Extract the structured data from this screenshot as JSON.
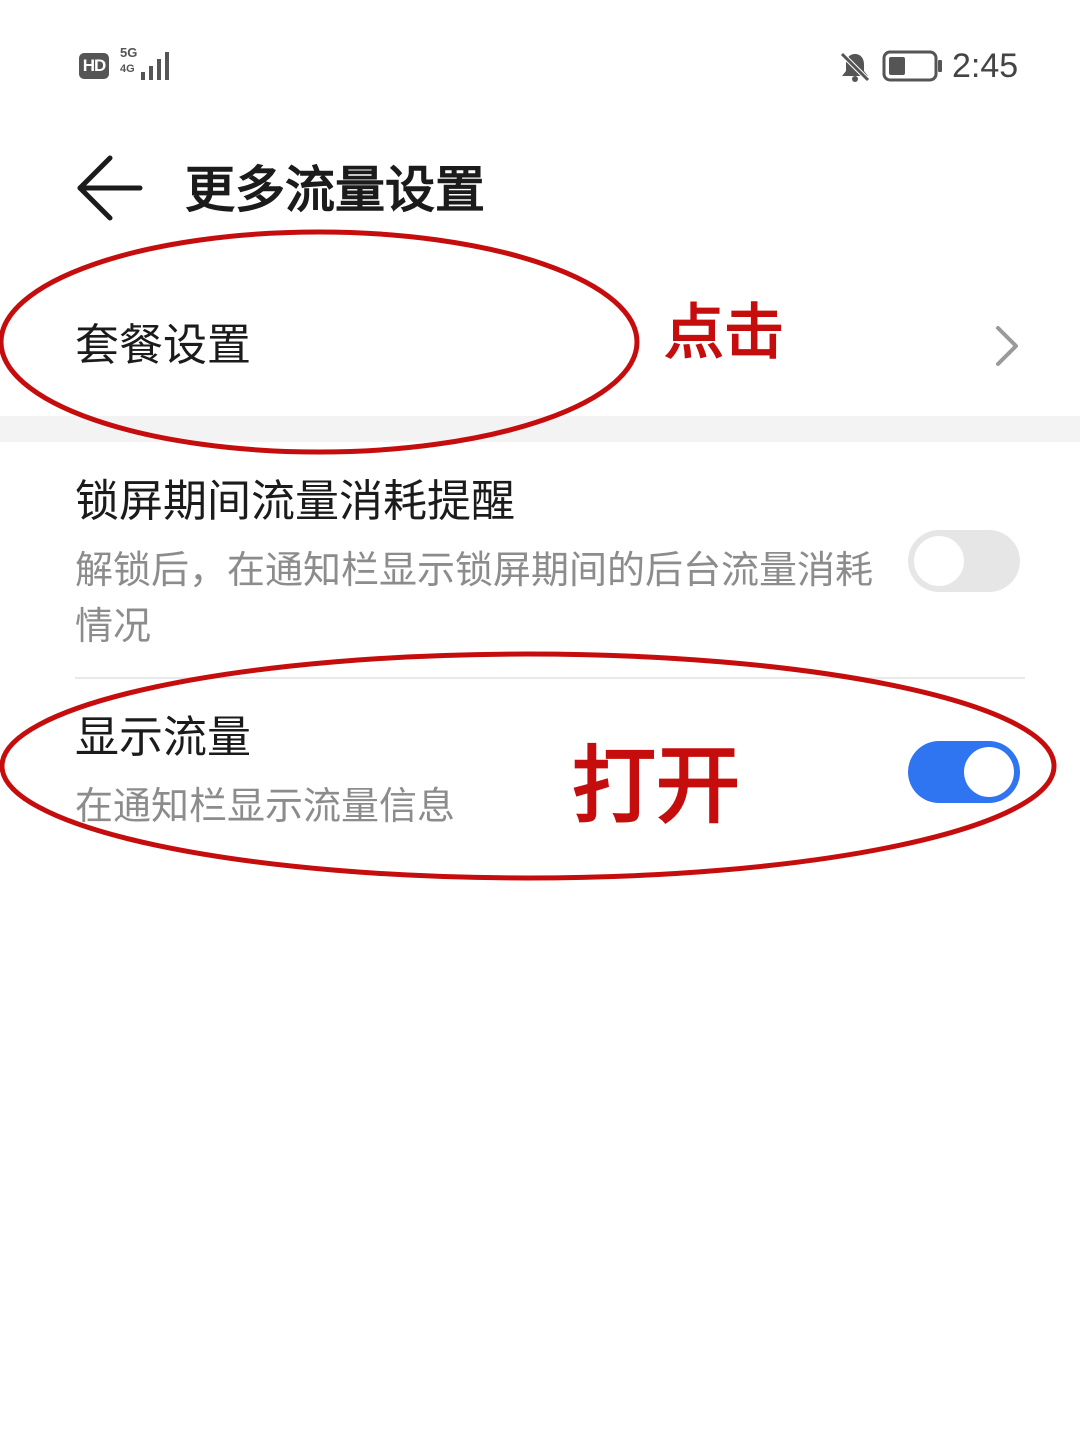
{
  "status_bar": {
    "hd_badge": "HD",
    "network_type": "5G",
    "network_sub": "4G",
    "time": "2:45",
    "icons": [
      "signal-icon",
      "mute-notification-icon",
      "battery-icon"
    ]
  },
  "header": {
    "title": "更多流量设置",
    "back_icon": "arrow-left-icon"
  },
  "plan_row": {
    "label": "套餐设置",
    "chevron_icon": "chevron-right-icon"
  },
  "lock_row": {
    "title": "锁屏期间流量消耗提醒",
    "description": "解锁后，在通知栏显示锁屏期间的后台流量消耗情况",
    "enabled": false
  },
  "show_row": {
    "title": "显示流量",
    "description": "在通知栏显示流量信息",
    "enabled": true
  },
  "annotations": {
    "click_text": "点击",
    "open_text": "打开",
    "color": "#c60d0d"
  },
  "colors": {
    "toggle_on": "#2f74f0",
    "toggle_off": "#e6e6e6",
    "secondary_text": "#8c8c8c"
  }
}
